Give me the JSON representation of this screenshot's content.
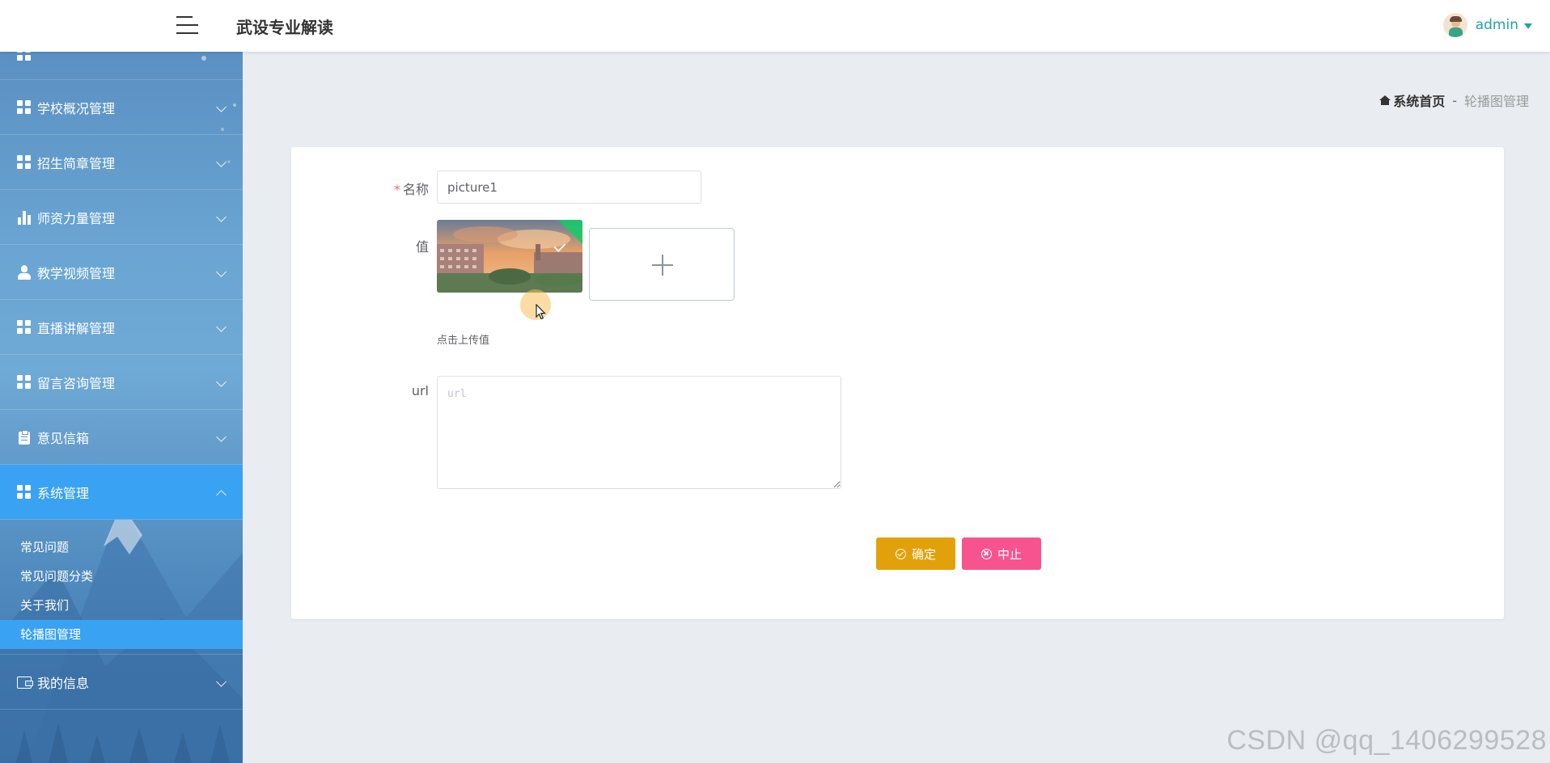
{
  "header": {
    "app_title": "武设专业解读",
    "user_name": "admin"
  },
  "sidebar": {
    "items": [
      {
        "label": "学校概况管理",
        "icon": "grid-icon"
      },
      {
        "label": "招生简章管理",
        "icon": "grid-icon"
      },
      {
        "label": "师资力量管理",
        "icon": "bar-chart-icon"
      },
      {
        "label": "教学视频管理",
        "icon": "user-icon"
      },
      {
        "label": "直播讲解管理",
        "icon": "grid-icon"
      },
      {
        "label": "留言咨询管理",
        "icon": "grid-icon"
      },
      {
        "label": "意见信箱",
        "icon": "clipboard-icon"
      },
      {
        "label": "系统管理",
        "icon": "grid-icon",
        "expanded": true
      }
    ],
    "sub_items": [
      "常见问题",
      "常见问题分类",
      "关于我们",
      "轮播图管理"
    ],
    "active_sub": "轮播图管理",
    "last_item": {
      "label": "我的信息",
      "icon": "wallet-icon"
    }
  },
  "breadcrumb": {
    "home": "系统首页",
    "separator": "-",
    "current": "轮播图管理"
  },
  "form": {
    "name_label": "名称",
    "name_value": "picture1",
    "value_label": "值",
    "upload_tip": "点击上传值",
    "url_label": "url",
    "url_placeholder": "url",
    "confirm_label": "确定",
    "cancel_label": "中止"
  },
  "colors": {
    "accent": "#39a2f2",
    "confirm": "#e2a10b",
    "cancel": "#f7548f",
    "username": "#22a2a6"
  },
  "watermark": "CSDN @qq_1406299528"
}
